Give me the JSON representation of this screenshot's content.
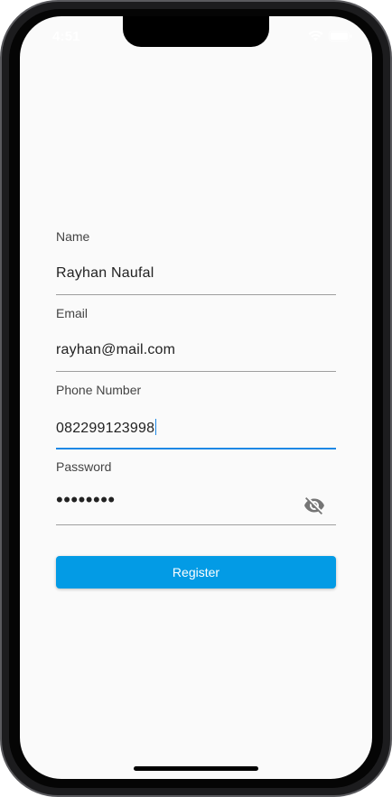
{
  "status_bar": {
    "time": "4:51"
  },
  "form": {
    "name": {
      "label": "Name",
      "value": "Rayhan Naufal"
    },
    "email": {
      "label": "Email",
      "value": "rayhan@mail.com"
    },
    "phone": {
      "label": "Phone Number",
      "value": "082299123998"
    },
    "password": {
      "label": "Password",
      "masked_value": "••••••••",
      "visibility_icon": "eye-off-icon"
    },
    "register_label": "Register"
  },
  "colors": {
    "accent": "#1e88e5",
    "button": "#039be5",
    "background": "#fafafa"
  }
}
